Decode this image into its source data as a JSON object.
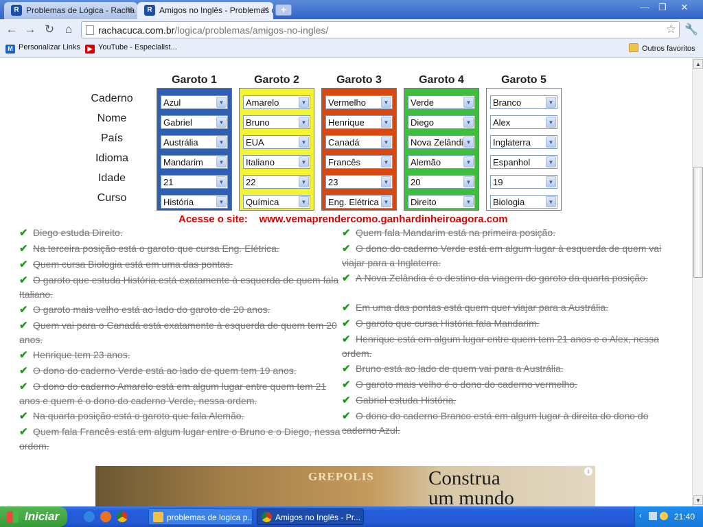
{
  "browser": {
    "tabs": [
      {
        "title": "Problemas de Lógica - Racha C"
      },
      {
        "title": "Amigos no Inglês - Problemas c"
      }
    ],
    "url_host": "rachacuca.com.br",
    "url_path": "/logica/problemas/amigos-no-ingles/",
    "bookmarks": [
      {
        "label": "Personalizar Links",
        "icon": "m-logo-icon"
      },
      {
        "label": "YouTube - Especialist..."
      }
    ],
    "other_bookmarks": "Outros favoritos"
  },
  "puzzle": {
    "columns": [
      "Garoto 1",
      "Garoto 2",
      "Garoto 3",
      "Garoto 4",
      "Garoto 5"
    ],
    "column_colors": [
      "#2f5fb2",
      "#f3f332",
      "#d9480f",
      "#3dbf3d",
      "#ffffff"
    ],
    "row_labels": [
      "Caderno",
      "Nome",
      "País",
      "Idioma",
      "Idade",
      "Curso"
    ],
    "grid": [
      [
        "Azul",
        "Amarelo",
        "Vermelho",
        "Verde",
        "Branco"
      ],
      [
        "Gabriel",
        "Bruno",
        "Henrique",
        "Diego",
        "Alex"
      ],
      [
        "Austrália",
        "EUA",
        "Canadá",
        "Nova Zelândi",
        "Inglaterra"
      ],
      [
        "Mandarim",
        "Italiano",
        "Francês",
        "Alemão",
        "Espanhol"
      ],
      [
        "21",
        "22",
        "23",
        "20",
        "19"
      ],
      [
        "História",
        "Química",
        "Eng. Elétrica",
        "Direito",
        "Biologia"
      ]
    ]
  },
  "promo": "Acesse o site:    www.vemaprendercomo.ganhardinheiroagora.com",
  "clues_left": [
    "Diego estuda Direito.",
    "Na terceira posição está o garoto que cursa Eng. Elétrica.",
    "Quem cursa Biologia está em uma das pontas.",
    "O garoto que estuda História está exatamente à esquerda de quem fala Italiano.",
    "O garoto mais velho está ao lado do garoto de 20 anos.",
    "Quem vai para o Canadá está exatamente à esquerda de quem tem 20 anos.",
    "Henrique tem 23 anos.",
    "O dono do caderno Verde está ao lado de quem tem 19 anos.",
    "O dono do caderno Amarelo está em algum lugar entre quem tem 21 anos e quem é o dono do caderno Verde, nessa ordem.",
    "Na quarta posição está o garoto que fala Alemão.",
    "Quem fala Francês está em algum lugar entre o Bruno e o Diego, nessa ordem."
  ],
  "clues_right": [
    "Quem fala Mandarim está na primeira posição.",
    "O dono do caderno Verde está em algum lugar à esquerda de quem vai viajar para a Inglaterra.",
    "A Nova Zelândia é o destino da viagem do garoto da quarta posição.",
    "Em uma das pontas está quem quer viajar para a Austrália.",
    "O garoto que cursa História fala Mandarim.",
    "Henrique está em algum lugar entre quem tem 21 anos e o Alex, nessa ordem.",
    "Bruno está ao lado de quem vai para a Austrália.",
    "O garoto mais velho é o dono do caderno vermelho.",
    "Gabriel estuda História.",
    "O dono do caderno Branco está em algum lugar à direita do dono do caderno Azul."
  ],
  "banner": {
    "logo": "GREPOLIS",
    "text_line1": "Construa",
    "text_line2": "um mundo"
  },
  "taskbar": {
    "start": "Iniciar",
    "tasks": [
      "problemas de logica p...",
      "Amigos no Inglês - Pr..."
    ],
    "clock": "21:40"
  }
}
